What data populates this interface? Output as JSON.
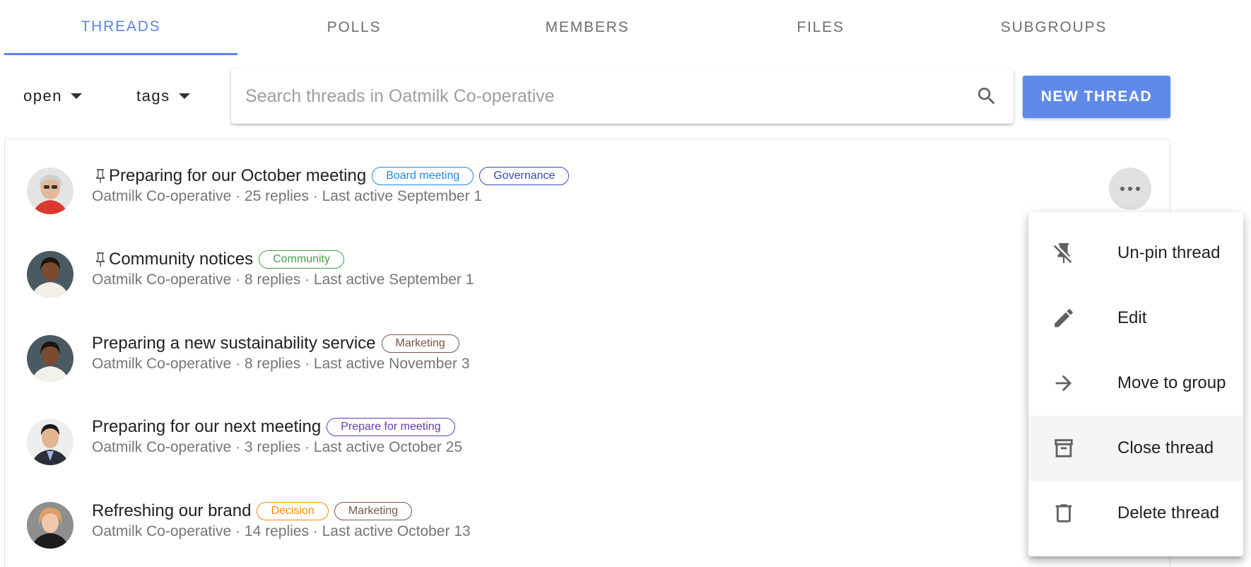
{
  "tabs": [
    {
      "label": "THREADS",
      "active": true
    },
    {
      "label": "POLLS",
      "active": false
    },
    {
      "label": "MEMBERS",
      "active": false
    },
    {
      "label": "FILES",
      "active": false
    },
    {
      "label": "SUBGROUPS",
      "active": false
    }
  ],
  "toolbar": {
    "status_filter": "open",
    "tags_filter": "tags",
    "search_placeholder": "Search threads in Oatmilk Co-operative",
    "new_thread_label": "NEW THREAD"
  },
  "threads": [
    {
      "pinned": true,
      "title": "Preparing for our October meeting",
      "tags": [
        {
          "label": "Board meeting",
          "color": "#1e88e5"
        },
        {
          "label": "Governance",
          "color": "#3949ab"
        }
      ],
      "meta": "Oatmilk Co-operative · 25 replies  · Last active September 1"
    },
    {
      "pinned": true,
      "title": "Community notices",
      "tags": [
        {
          "label": "Community",
          "color": "#43a047"
        }
      ],
      "meta": "Oatmilk Co-operative · 8 replies  · Last active September 1"
    },
    {
      "pinned": false,
      "title": "Preparing a new sustainability service",
      "tags": [
        {
          "label": "Marketing",
          "color": "#795548"
        }
      ],
      "meta": "Oatmilk Co-operative · 8 replies  · Last active November 3"
    },
    {
      "pinned": false,
      "title": "Preparing for our next meeting",
      "tags": [
        {
          "label": "Prepare for meeting",
          "color": "#673ab7"
        }
      ],
      "meta": "Oatmilk Co-operative · 3 replies  · Last active October 25"
    },
    {
      "pinned": false,
      "title": "Refreshing our brand",
      "tags": [
        {
          "label": "Decision",
          "color": "#fb8c00"
        },
        {
          "label": "Marketing",
          "color": "#795548"
        }
      ],
      "meta": "Oatmilk Co-operative · 14 replies  · Last active October 13"
    }
  ],
  "menu": {
    "items": [
      {
        "label": "Un-pin thread",
        "icon": "pin-off-icon"
      },
      {
        "label": "Edit",
        "icon": "pencil-icon"
      },
      {
        "label": "Move to group",
        "icon": "arrow-right-icon"
      },
      {
        "label": "Close thread",
        "icon": "archive-icon",
        "hovered": true
      },
      {
        "label": "Delete thread",
        "icon": "trash-icon"
      }
    ]
  },
  "colors": {
    "accent": "#5b84e6",
    "button": "#5f8ae9",
    "meta_text": "#757575"
  }
}
